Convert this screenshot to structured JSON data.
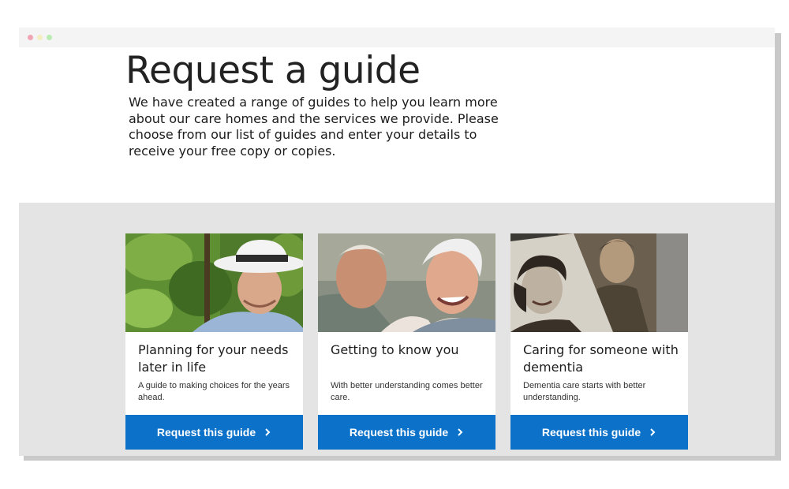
{
  "page": {
    "title": "Request a guide",
    "intro": "We have created a range of guides to help you learn more about our care homes and the services we provide. Please choose from our list of guides and enter your details to receive your free copy or copies."
  },
  "window_dots": [
    "close",
    "minimize",
    "maximize"
  ],
  "guides": [
    {
      "title": "Planning for your needs later in life",
      "description": "A guide to making choices for the years ahead.",
      "button_label": "Request this guide",
      "icon": "chevron-right-icon"
    },
    {
      "title": "Getting to know you",
      "description": "With better understanding comes better care.",
      "button_label": "Request this guide",
      "icon": "chevron-right-icon"
    },
    {
      "title": "Caring for someone with dementia",
      "description": "Dementia care starts with better understanding.",
      "button_label": "Request this guide",
      "icon": "chevron-right-icon"
    }
  ],
  "colors": {
    "button": "#0b71c9",
    "band": "#e4e4e4",
    "title_bar": "#f4f4f4"
  }
}
